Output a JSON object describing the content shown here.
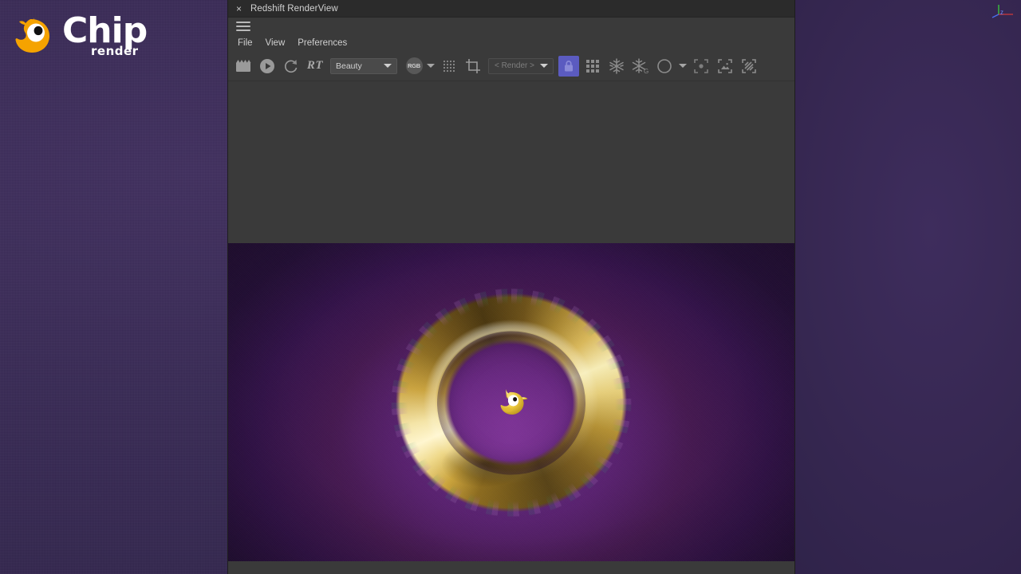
{
  "desktop": {
    "background_color": "#382a54",
    "logo": {
      "name_primary": "Chip",
      "name_secondary": "render",
      "bird_body_color": "#f5a300",
      "text_color": "#ffffff"
    }
  },
  "window": {
    "title": "Redshift RenderView",
    "close_glyph": "×",
    "titlebar_color": "#2b2b2b",
    "chrome_color": "#3a3a3a"
  },
  "menu": {
    "hamburger_name": "menu-icon",
    "items": [
      {
        "label": "File"
      },
      {
        "label": "View"
      },
      {
        "label": "Preferences"
      }
    ]
  },
  "toolbar": {
    "accent_active_color": "#5b5bc0",
    "icon_color": "#9a9a9a",
    "rt_label": "RT",
    "aov_select": {
      "value": "Beauty",
      "options": [
        "Beauty"
      ]
    },
    "rgb_button_label": "RGB",
    "render_select": {
      "value": "< Render >",
      "options": [
        "< Render >"
      ]
    },
    "buttons": [
      {
        "name": "render-clapper-button",
        "tooltip": "Render"
      },
      {
        "name": "play-button",
        "tooltip": "Start IPR"
      },
      {
        "name": "refresh-button",
        "tooltip": "Refresh"
      },
      {
        "name": "rt-toggle",
        "tooltip": "RT"
      },
      {
        "name": "aov-dropdown",
        "tooltip": "AOV"
      },
      {
        "name": "rgb-channel-button",
        "tooltip": "RGB"
      },
      {
        "name": "rgb-channel-dropdown",
        "tooltip": "Channel options"
      },
      {
        "name": "pixel-grid-button",
        "tooltip": "Pixel grid"
      },
      {
        "name": "crop-region-button",
        "tooltip": "Crop region"
      },
      {
        "name": "render-list-dropdown",
        "tooltip": "Render list"
      },
      {
        "name": "lock-button",
        "tooltip": "Lock",
        "active": true
      },
      {
        "name": "tiles-button",
        "tooltip": "Buckets"
      },
      {
        "name": "denoise-button",
        "tooltip": "Denoise"
      },
      {
        "name": "denoise-gpu-button",
        "tooltip": "Denoise G"
      },
      {
        "name": "circle-button",
        "tooltip": "Region shape"
      },
      {
        "name": "circle-dropdown",
        "tooltip": "Region shape options"
      },
      {
        "name": "focus-region-button",
        "tooltip": "Focus region"
      },
      {
        "name": "image-region-button",
        "tooltip": "Image region"
      },
      {
        "name": "stripes-region-button",
        "tooltip": "Diagonal region"
      }
    ]
  },
  "render_view": {
    "background_color": "#33124a",
    "subject": "golden torus with chip bird logo",
    "gold_color": "#e5cd79",
    "bird_color": "#e8c53a"
  },
  "axis_gizmo": {
    "x_label": "x",
    "y_label": "y",
    "z_label": "z",
    "x_color": "#d03a3a",
    "y_color": "#3ad03a",
    "z_color": "#4a6ff0"
  }
}
